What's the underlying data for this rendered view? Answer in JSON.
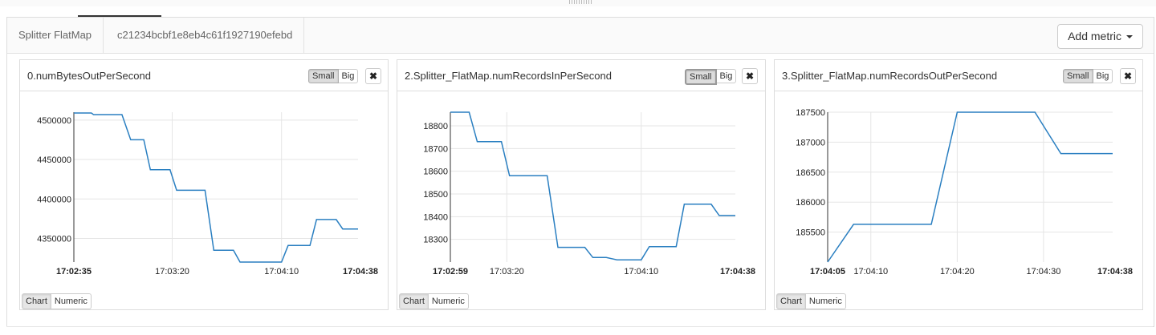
{
  "subtabs": [
    "Splitter FlatMap",
    "c21234bcbf1e8eb4c61f1927190efebd"
  ],
  "add_metric_label": "Add metric",
  "size_labels": {
    "small": "Small",
    "big": "Big"
  },
  "close_glyph": "✖",
  "mode_labels": {
    "chart": "Chart",
    "numeric": "Numeric"
  },
  "line_color": "#2a7fc1",
  "chart_data": [
    {
      "type": "line",
      "title": "0.numBytesOutPerSecond",
      "size_active": "small",
      "x_start": "17:02:35",
      "x_end": "17:04:38",
      "x_ticks": [
        {
          "t": 0,
          "label": "17:02:35",
          "bold": true
        },
        {
          "t": 45,
          "label": "17:03:20",
          "bold": false
        },
        {
          "t": 95,
          "label": "17:04:10",
          "bold": false
        },
        {
          "t": 123,
          "label": "17:04:38",
          "bold": true
        }
      ],
      "ylim": [
        4320000,
        4510000
      ],
      "y_ticks": [
        4350000,
        4400000,
        4450000,
        4500000
      ],
      "points": [
        [
          0,
          4509000
        ],
        [
          8,
          4509000
        ],
        [
          9,
          4507000
        ],
        [
          22,
          4507000
        ],
        [
          26,
          4475000
        ],
        [
          32,
          4475000
        ],
        [
          35,
          4437000
        ],
        [
          44,
          4437000
        ],
        [
          47,
          4411000
        ],
        [
          60,
          4411000
        ],
        [
          64,
          4335000
        ],
        [
          73,
          4335000
        ],
        [
          76,
          4320000
        ],
        [
          95,
          4320000
        ],
        [
          98,
          4341000
        ],
        [
          108,
          4341000
        ],
        [
          111,
          4374000
        ],
        [
          120,
          4374000
        ],
        [
          123,
          4362000
        ],
        [
          130,
          4362000
        ]
      ]
    },
    {
      "type": "line",
      "title": "2.Splitter_FlatMap.numRecordsInPerSecond",
      "size_active": "small",
      "x_start": "17:02:59",
      "x_end": "17:04:38",
      "x_ticks": [
        {
          "t": 0,
          "label": "17:02:59",
          "bold": true
        },
        {
          "t": 21,
          "label": "17:03:20",
          "bold": false
        },
        {
          "t": 71,
          "label": "17:04:10",
          "bold": false
        },
        {
          "t": 99,
          "label": "17:04:38",
          "bold": true
        }
      ],
      "ylim": [
        18200,
        18860
      ],
      "y_ticks": [
        18300,
        18400,
        18500,
        18600,
        18700,
        18800
      ],
      "points": [
        [
          0,
          18860
        ],
        [
          7,
          18860
        ],
        [
          10,
          18730
        ],
        [
          19,
          18730
        ],
        [
          22,
          18580
        ],
        [
          36,
          18580
        ],
        [
          40,
          18265
        ],
        [
          50,
          18265
        ],
        [
          53,
          18220
        ],
        [
          58,
          18220
        ],
        [
          62,
          18210
        ],
        [
          71,
          18210
        ],
        [
          74,
          18268
        ],
        [
          84,
          18268
        ],
        [
          87,
          18455
        ],
        [
          97,
          18455
        ],
        [
          100,
          18405
        ],
        [
          106,
          18405
        ]
      ]
    },
    {
      "type": "line",
      "title": "3.Splitter_FlatMap.numRecordsOutPerSecond",
      "size_active": "small",
      "x_start": "17:04:05",
      "x_end": "17:04:38",
      "x_ticks": [
        {
          "t": 0,
          "label": "17:04:05",
          "bold": true
        },
        {
          "t": 5,
          "label": "17:04:10",
          "bold": false
        },
        {
          "t": 15,
          "label": "17:04:20",
          "bold": false
        },
        {
          "t": 25,
          "label": "17:04:30",
          "bold": false
        },
        {
          "t": 33,
          "label": "17:04:38",
          "bold": true
        }
      ],
      "ylim": [
        185000,
        187500
      ],
      "y_ticks": [
        185500,
        186000,
        186500,
        187000,
        187500
      ],
      "points": [
        [
          0,
          185000
        ],
        [
          3,
          185630
        ],
        [
          12,
          185630
        ],
        [
          15,
          187500
        ],
        [
          24,
          187500
        ],
        [
          27,
          186810
        ],
        [
          33,
          186810
        ]
      ]
    }
  ]
}
